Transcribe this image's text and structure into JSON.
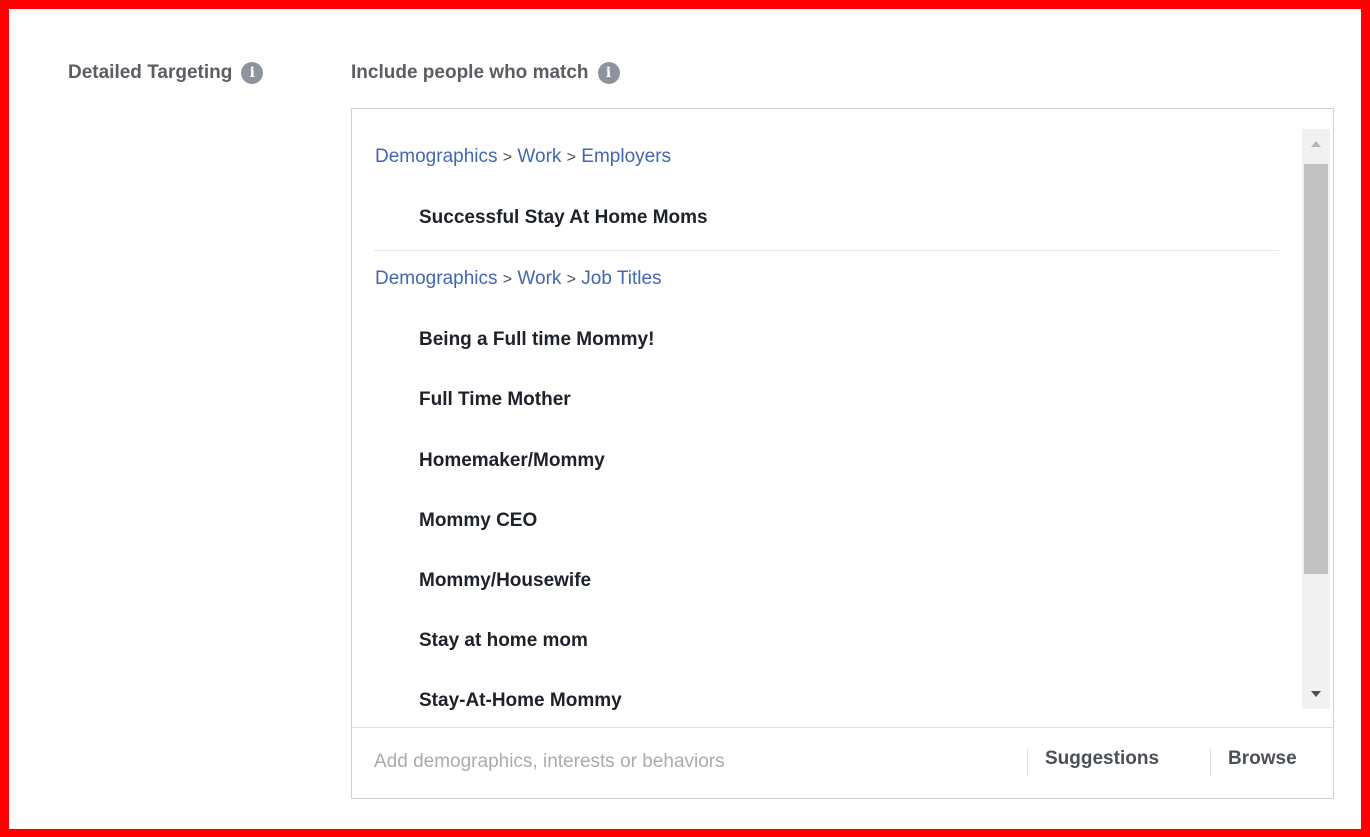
{
  "section": {
    "label": "Detailed Targeting",
    "sublabel": "Include people who match"
  },
  "targeting": {
    "groups": [
      {
        "breadcrumb": [
          "Demographics",
          "Work",
          "Employers"
        ],
        "separator": ">",
        "items": [
          "Successful Stay At Home Moms"
        ]
      },
      {
        "breadcrumb": [
          "Demographics",
          "Work",
          "Job Titles"
        ],
        "separator": ">",
        "items": [
          "Being a Full time Mommy!",
          "Full Time Mother",
          "Homemaker/Mommy",
          "Mommy CEO",
          "Mommy/Housewife",
          "Stay at home mom",
          "Stay-At-Home Mommy"
        ]
      }
    ]
  },
  "footer": {
    "input_placeholder": "Add demographics, interests or behaviors",
    "input_value": "",
    "suggestions_label": "Suggestions",
    "browse_label": "Browse"
  },
  "icons": {
    "info": "info-icon",
    "scroll_up": "arrow-up-icon",
    "scroll_down": "arrow-down-icon"
  },
  "colors": {
    "frame": "#ff0000",
    "link": "#4267b2",
    "label": "#5a5d62"
  }
}
